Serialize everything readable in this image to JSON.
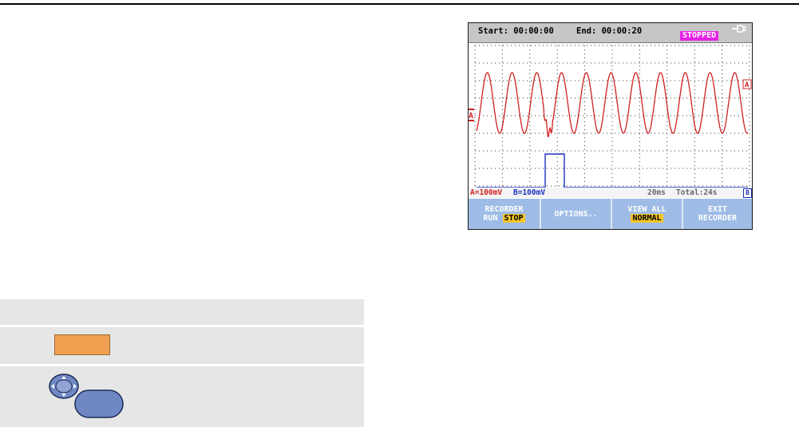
{
  "scope": {
    "header": {
      "start": "Start: 00:00:00",
      "end": "End: 00:00:20",
      "status": "STOPPED",
      "status_color": "#e623e6",
      "power_icon": "power-plug-icon"
    },
    "channels": {
      "a_marker": "A",
      "b_marker": "B",
      "a_color": "#d02020",
      "b_color": "#1a30c0"
    },
    "statusbar": {
      "a_scale": "A=100mV",
      "b_scale": "B=100mV",
      "timebase": "20ms",
      "total": "Total:24s",
      "marker": "B"
    },
    "softkeys": [
      {
        "line1": "RECORDER",
        "line2_plain": "RUN",
        "line2_highlight": "STOP"
      },
      {
        "line1": "OPTIONS.."
      },
      {
        "line1": "VIEW ALL",
        "line2_highlight": "NORMAL"
      },
      {
        "line1": "EXIT",
        "line2_plain": "RECORDER"
      }
    ],
    "softkey_color": "#9ebce6",
    "highlight_color": "#f3c52a"
  },
  "table": {
    "row_color": "#e6e6e6",
    "button_color": "#f0a050",
    "nav_icon": "arrow-navigation-icon",
    "button_icon": "oval-button-icon"
  }
}
